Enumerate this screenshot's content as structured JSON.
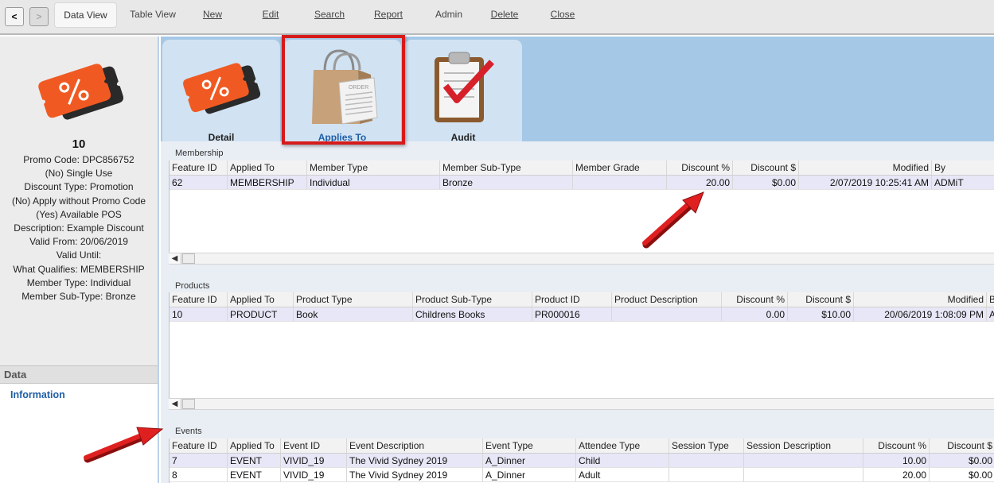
{
  "toolbar": {
    "back": "<",
    "forward": ">",
    "items": [
      "Data View",
      "Table View",
      "New",
      "Edit",
      "Search",
      "Report",
      "Admin",
      "Delete",
      "Close"
    ],
    "underline_chars": [
      "",
      "",
      "N",
      "E",
      "S",
      "R",
      "",
      "D",
      "C"
    ]
  },
  "left": {
    "icon": "discount-tag-icon",
    "promo_number": "10",
    "lines": [
      "Promo Code: DPC856752",
      "(No) Single Use",
      "Discount Type: Promotion",
      "(No) Apply without Promo Code",
      "(Yes) Available POS",
      "Description: Example Discount",
      "Valid From: 20/06/2019",
      "Valid Until:",
      "What Qualifies: MEMBERSHIP",
      "Member Type: Individual",
      "Member Sub-Type: Bronze"
    ],
    "data_header": "Data",
    "info_link": "Information"
  },
  "tabs": [
    {
      "label": "Detail",
      "icon": "discount-tag-icon"
    },
    {
      "label": "Applies To",
      "icon": "shopping-bag-icon"
    },
    {
      "label": "Audit",
      "icon": "clipboard-check-icon"
    }
  ],
  "colors": {
    "accent": "#1f5fa8",
    "highlight": "#d61a1a",
    "tab_strip": "#a5c8e6",
    "tag_orange": "#f05a22"
  },
  "membership": {
    "title": "Membership",
    "columns": [
      "Feature ID",
      "Applied To",
      "Member Type",
      "Member Sub-Type",
      "Member Grade",
      "Discount %",
      "Discount $",
      "Modified",
      "By"
    ],
    "rows": [
      [
        "62",
        "MEMBERSHIP",
        "Individual",
        "Bronze",
        "",
        "20.00",
        "$0.00",
        "2/07/2019 10:25:41 AM",
        "ADMiT"
      ]
    ]
  },
  "products": {
    "title": "Products",
    "columns": [
      "Feature ID",
      "Applied To",
      "Product Type",
      "Product Sub-Type",
      "Product ID",
      "Product Description",
      "Discount %",
      "Discount $",
      "Modified",
      "B"
    ],
    "rows": [
      [
        "10",
        "PRODUCT",
        "Book",
        "Childrens Books",
        "PR000016",
        "",
        "0.00",
        "$10.00",
        "20/06/2019 1:08:09 PM",
        "A"
      ]
    ]
  },
  "events": {
    "title": "Events",
    "columns": [
      "Feature ID",
      "Applied To",
      "Event ID",
      "Event Description",
      "Event Type",
      "Attendee Type",
      "Session Type",
      "Session Description",
      "Discount %",
      "Discount $"
    ],
    "rows": [
      [
        "7",
        "EVENT",
        "VIVID_19",
        "The Vivid Sydney 2019",
        "A_Dinner",
        "Child",
        "",
        "",
        "10.00",
        "$0.00"
      ],
      [
        "8",
        "EVENT",
        "VIVID_19",
        "The Vivid Sydney 2019",
        "A_Dinner",
        "Adult",
        "",
        "",
        "20.00",
        "$0.00"
      ]
    ]
  }
}
